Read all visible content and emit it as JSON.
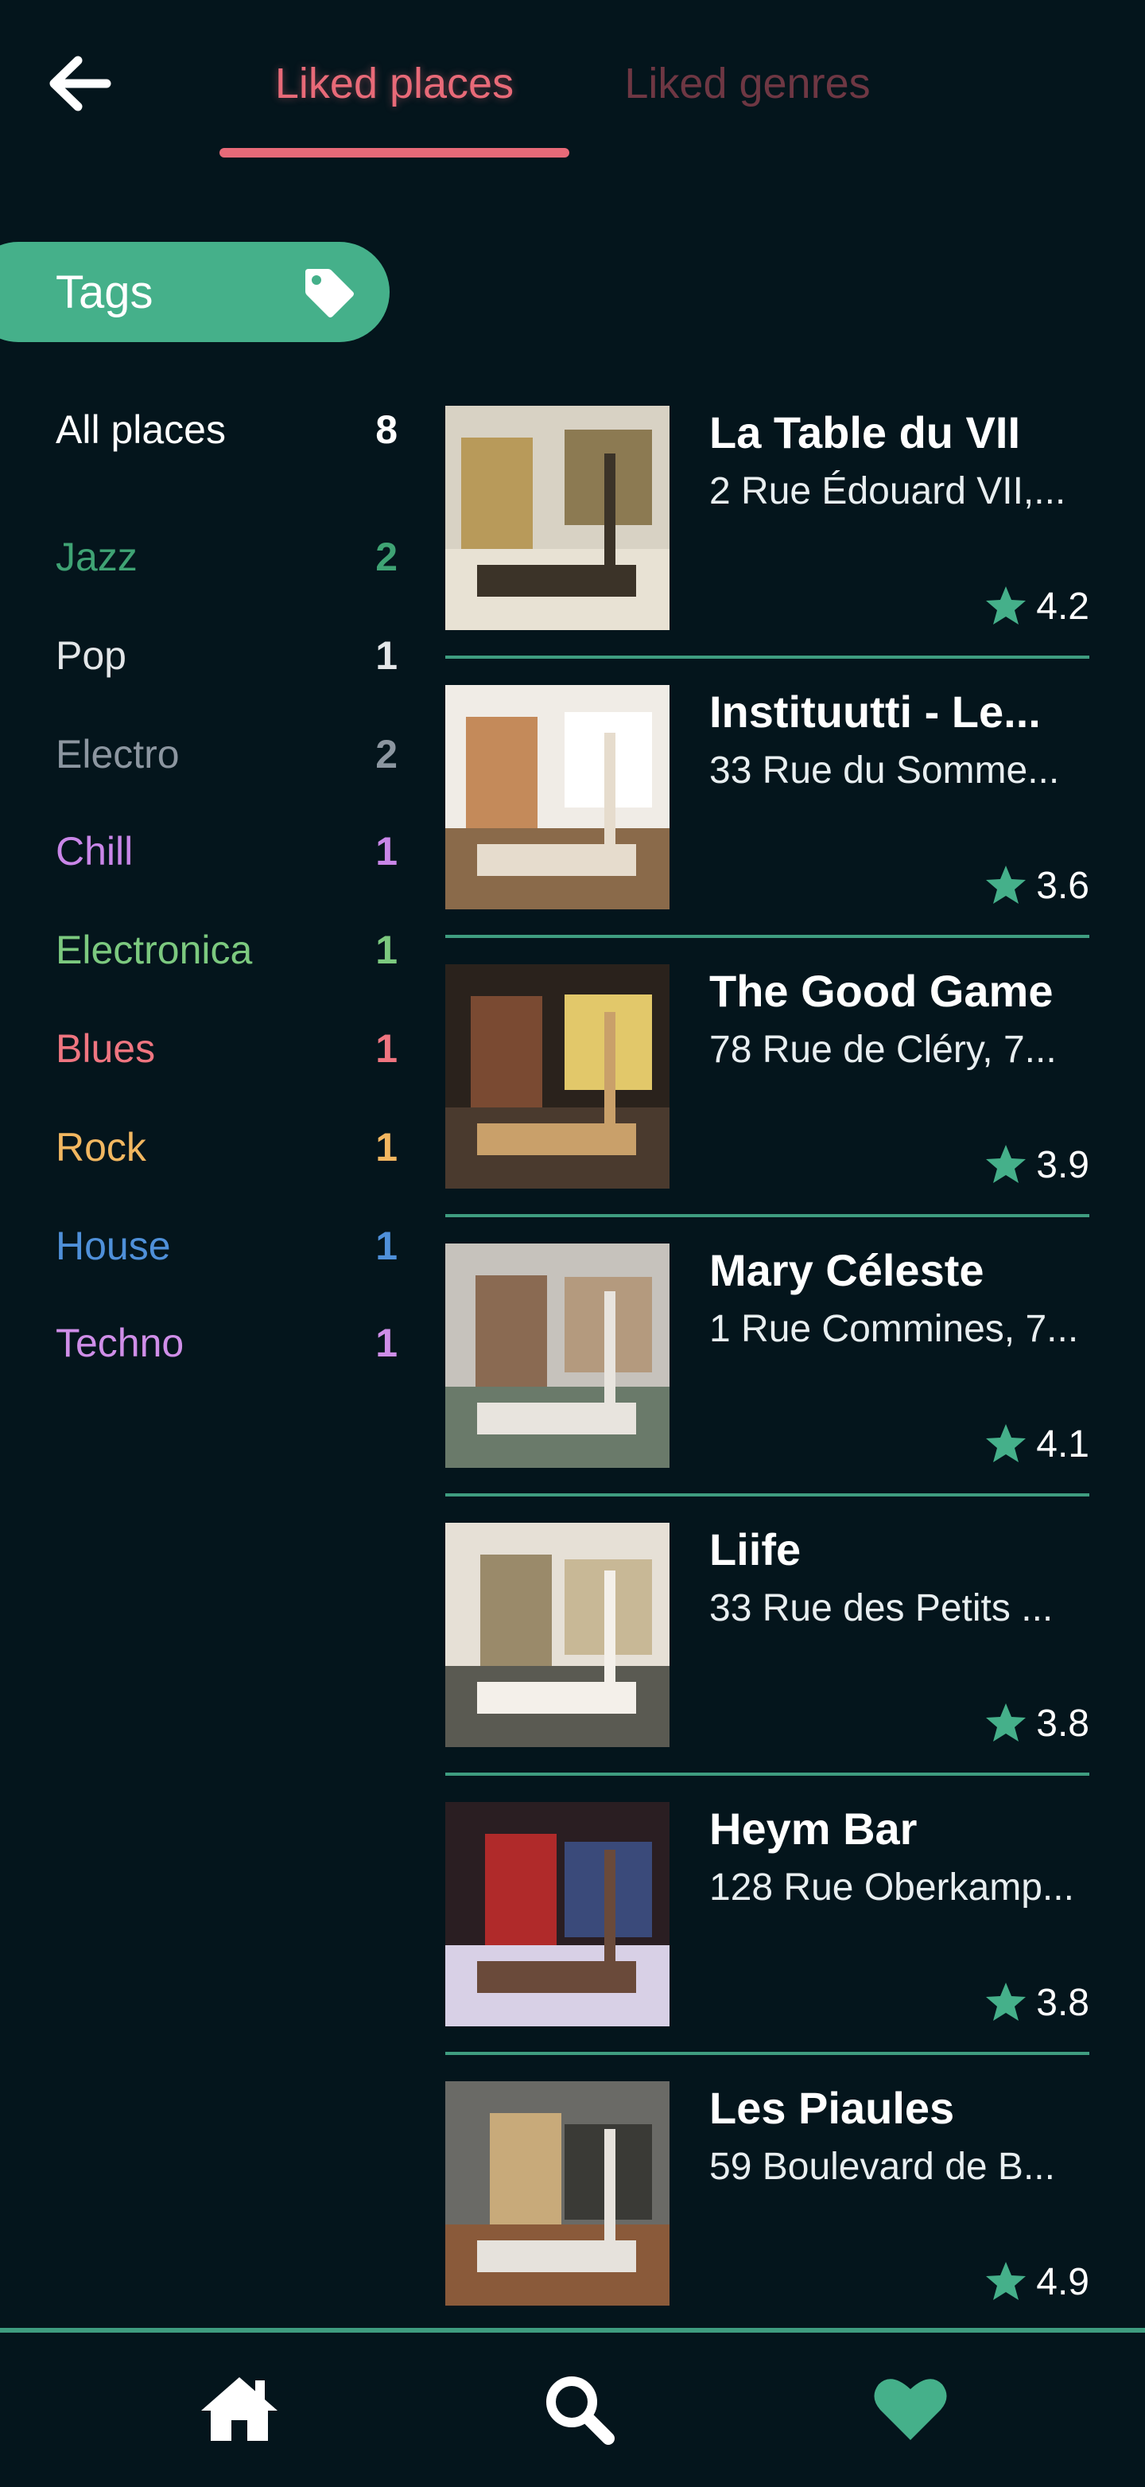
{
  "header": {
    "tabs": [
      {
        "label": "Liked places",
        "active": true
      },
      {
        "label": "Liked genres",
        "active": false
      }
    ]
  },
  "tags": {
    "label": "Tags"
  },
  "genres": [
    {
      "label": "All places",
      "count": "8",
      "color": "#ffffff"
    },
    {
      "label": "Jazz",
      "count": "2",
      "color": "#3fa374"
    },
    {
      "label": "Pop",
      "count": "1",
      "color": "#e3e6e8"
    },
    {
      "label": "Electro",
      "count": "2",
      "color": "#8c96a0"
    },
    {
      "label": "Chill",
      "count": "1",
      "color": "#c986e8"
    },
    {
      "label": "Electronica",
      "count": "1",
      "color": "#7cc97f"
    },
    {
      "label": "Blues",
      "count": "1",
      "color": "#ef7580"
    },
    {
      "label": "Rock",
      "count": "1",
      "color": "#f2b760"
    },
    {
      "label": "House",
      "count": "1",
      "color": "#4f90d9"
    },
    {
      "label": "Techno",
      "count": "1",
      "color": "#cf8ee8"
    }
  ],
  "places": [
    {
      "name": "La Table du VII",
      "address": "2 Rue Édouard VII,...",
      "rating": "4.2"
    },
    {
      "name": "Instituutti - Le...",
      "address": "33 Rue du Somme...",
      "rating": "3.6"
    },
    {
      "name": "The Good Game",
      "address": "78 Rue de Cléry, 7...",
      "rating": "3.9"
    },
    {
      "name": "Mary Céleste",
      "address": "1 Rue Commines, 7...",
      "rating": "4.1"
    },
    {
      "name": "Liife",
      "address": "33 Rue des Petits ...",
      "rating": "3.8"
    },
    {
      "name": "Heym Bar",
      "address": "128 Rue Oberkamp...",
      "rating": "3.8"
    },
    {
      "name": "Les Piaules",
      "address": "59 Boulevard de B...",
      "rating": "4.9"
    }
  ],
  "bottom_nav": [
    {
      "icon": "home-icon"
    },
    {
      "icon": "search-icon"
    },
    {
      "icon": "heart-icon"
    }
  ],
  "colors": {
    "background": "#04151c",
    "accent_green": "#45b08a",
    "accent_pink": "#e86a78",
    "divider": "#3f9d80"
  }
}
